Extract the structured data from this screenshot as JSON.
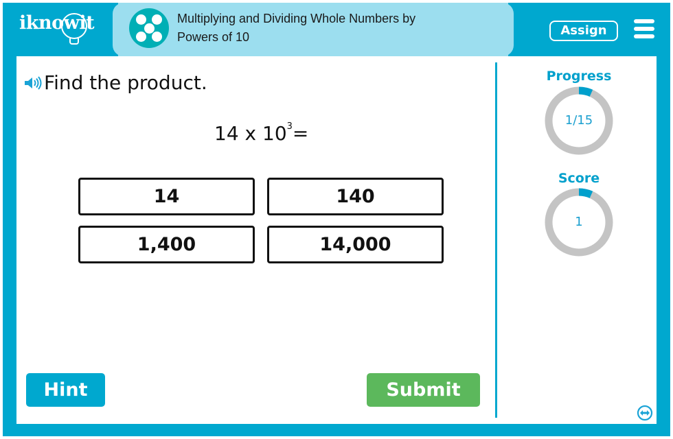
{
  "brand": {
    "logo_text": "iknowit"
  },
  "header": {
    "title_line1": "Multiplying and Dividing Whole Numbers by",
    "title_line2": "Powers of 10",
    "topic_icon": "five-dots-icon",
    "assign_label": "Assign",
    "menu_icon": "hamburger-menu-icon"
  },
  "question": {
    "audio_icon": "speaker-icon",
    "prompt": "Find the product.",
    "equation_base": "14 x 10",
    "equation_exponent": "3",
    "equation_suffix": "="
  },
  "answers": [
    {
      "label": "14"
    },
    {
      "label": "140"
    },
    {
      "label": "1,400"
    },
    {
      "label": "14,000"
    }
  ],
  "buttons": {
    "hint": "Hint",
    "submit": "Submit"
  },
  "sidebar": {
    "progress": {
      "label": "Progress",
      "value_text": "1/15",
      "current": 1,
      "total": 15
    },
    "score": {
      "label": "Score",
      "value_text": "1",
      "fraction": 0.0667
    },
    "expand_icon": "expand-horizontal-icon"
  },
  "colors": {
    "brand_blue": "#00a8cf",
    "title_bg": "#9cdeef",
    "topic_icon_bg": "#00afb5",
    "submit_green": "#5cb85c",
    "ring_track": "#c4c4c4",
    "ring_fill": "#00a0cc"
  }
}
